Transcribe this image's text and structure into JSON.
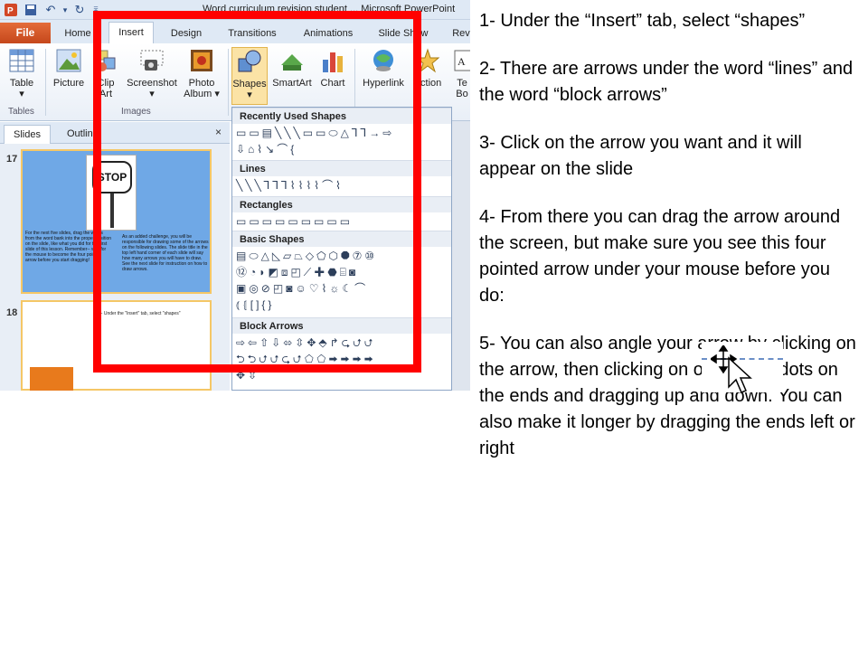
{
  "app": {
    "window_title": "Word curriculum revision student ... Microsoft PowerPoint",
    "file_tab": "File",
    "tabs": [
      "Home",
      "Insert",
      "Design",
      "Transitions",
      "Animations",
      "Slide Show",
      "Rev"
    ],
    "active_tab": "Insert"
  },
  "ribbon": {
    "buttons": [
      {
        "label": "Table",
        "sub": "▾",
        "icon": "table-icon"
      },
      {
        "label": "Picture",
        "icon": "picture-icon"
      },
      {
        "label": "Clip",
        "sub": "Art",
        "icon": "clip-art-icon"
      },
      {
        "label": "Screenshot",
        "sub": "▾",
        "icon": "screenshot-icon"
      },
      {
        "label": "Photo",
        "sub": "Album ▾",
        "icon": "photo-album-icon"
      },
      {
        "label": "Shapes",
        "sub": "▾",
        "icon": "shapes-icon"
      },
      {
        "label": "SmartArt",
        "icon": "smartart-icon"
      },
      {
        "label": "Chart",
        "icon": "chart-icon"
      },
      {
        "label": "Hyperlink",
        "icon": "hyperlink-icon"
      },
      {
        "label": "Action",
        "icon": "action-icon"
      },
      {
        "label": "Te",
        "sub": "Bo",
        "icon": "text-box-icon"
      }
    ],
    "groups": [
      "Tables",
      "Images"
    ]
  },
  "pane": {
    "tabs": [
      "Slides",
      "Outline"
    ],
    "close": "×",
    "slides": [
      {
        "number": "17",
        "sign_text": "STOP",
        "left_text": "For the next five slides, drag the words from the word bank into the proper position on the slide, like what you did for the first slide of this lesson. Remember-- wait for the mouse to become the four pointed arrow before you start dragging!",
        "right_text": "As an added challenge, you will be responsible for drawing some of the arrows on the following slides. The slide title in the top left hand corner of each slide will say how many arrows you will have to draw. See the next slide for instruction on how to draw arrows."
      },
      {
        "number": "18",
        "title_text": "1- Under the \"Insert\" tab, select \"shapes\""
      }
    ]
  },
  "shapes_menu": {
    "sections": [
      {
        "title": "Recently Used Shapes",
        "rows": [
          "▭▭▤╲╲╲▭▭⬭△⅂⅂→⇨",
          "⇩⌂⌇↘⌒{"
        ]
      },
      {
        "title": "Lines",
        "rows": [
          "╲╲╲⅂⅂⅂⌇⌇⌇⌇⌒⌇"
        ]
      },
      {
        "title": "Rectangles",
        "rows": [
          "▭▭▭▭▭▭▭▭▭"
        ]
      },
      {
        "title": "Basic Shapes",
        "rows": [
          "▤⬭△◺▱⏢◇⬠⬡⯃⑦⑩",
          "⑫◔◗◩⧈◰⟋✚⬣⌸◙",
          "▣◎⊘◰◙☺♡⌇☼☾⌒",
          "⦅⦃[]{}"
        ]
      },
      {
        "title": "Block Arrows",
        "rows": [
          "⇨⇦⇧⇩⬄⇳✥⬘↱⮎⮍⮍",
          "⮌⮌⮍⮍⮎⮍⬠⬠⮕⮕⮕⮕",
          "✥⇳"
        ]
      }
    ]
  },
  "instructions": [
    "1- Under the “Insert” tab, select “shapes”",
    "2- There are arrows under the word “lines” and the word “block arrows”",
    "3- Click on the arrow you want and it will appear on the slide",
    "4- From there you can drag the arrow around the screen, but make sure you see this four pointed arrow under your mouse before you do:",
    "5- You can also angle your arrow by clicking on the arrow, then clicking on one of the dots on the ends and dragging up and down. You can also make it longer by dragging the ends left or right"
  ],
  "colors": {
    "highlight_frame": "#ff0000",
    "file_tab": "#d2542a",
    "slide_bg": "#6fa8e6"
  }
}
